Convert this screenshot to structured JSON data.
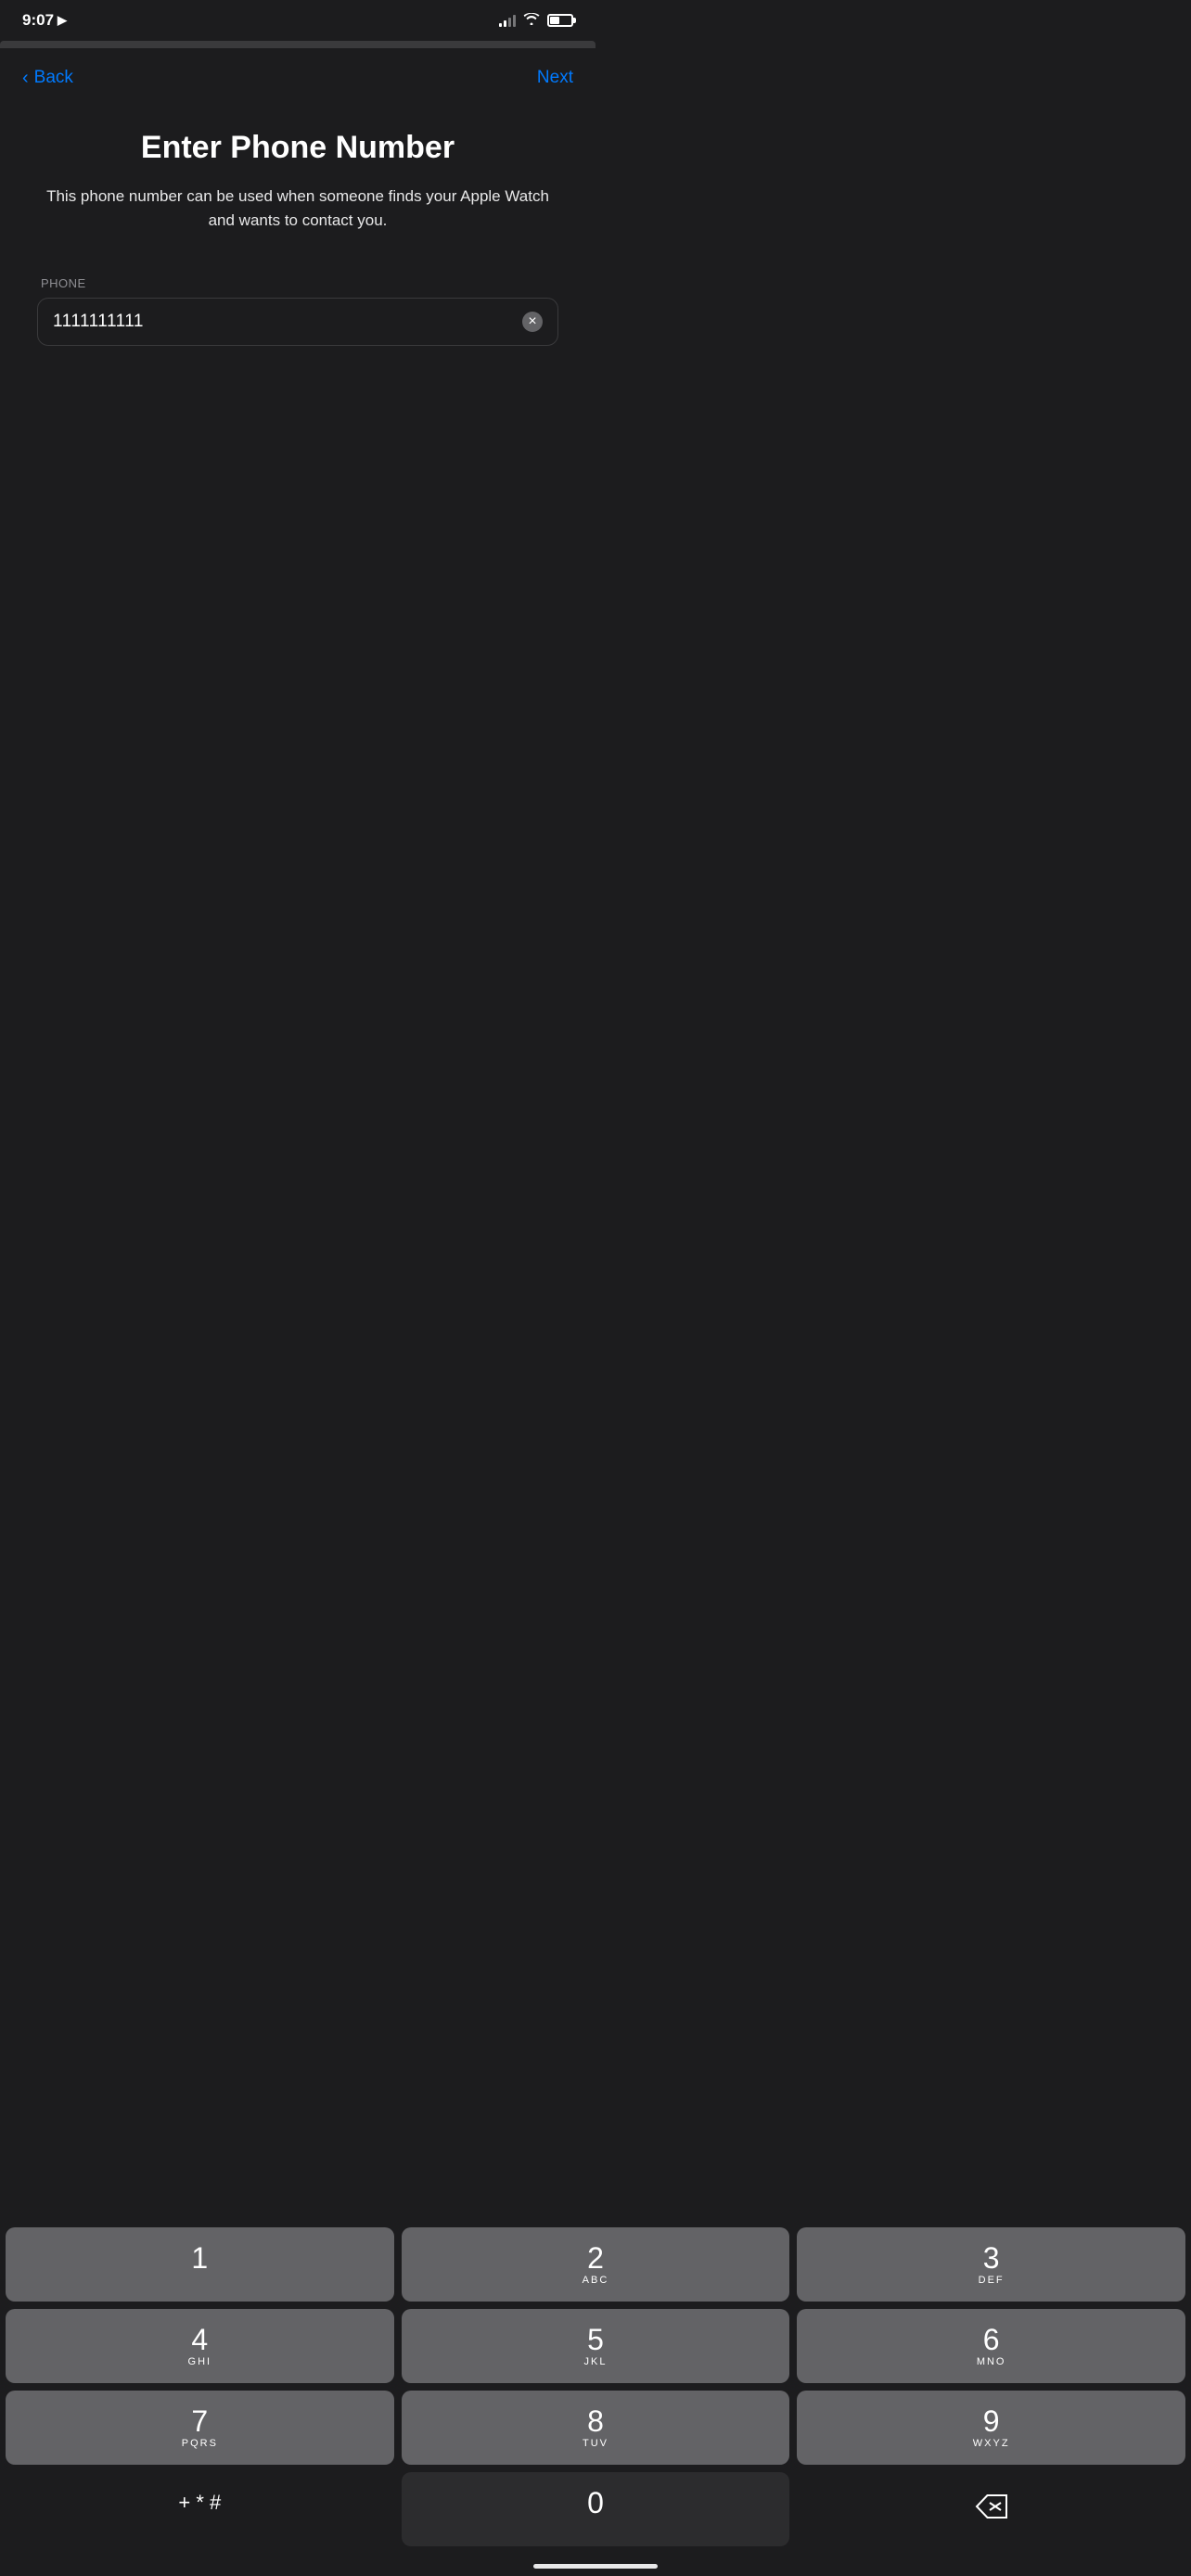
{
  "statusBar": {
    "time": "9:07",
    "locationIcon": "▶"
  },
  "nav": {
    "backLabel": "Back",
    "nextLabel": "Next"
  },
  "page": {
    "title": "Enter Phone Number",
    "subtitle": "This phone number can be used when someone finds your Apple Watch and wants to contact you."
  },
  "phoneField": {
    "label": "PHONE",
    "value": "1111111111",
    "clearLabel": "clear"
  },
  "keypad": {
    "rows": [
      [
        {
          "main": "1",
          "sub": ""
        },
        {
          "main": "2",
          "sub": "ABC"
        },
        {
          "main": "3",
          "sub": "DEF"
        }
      ],
      [
        {
          "main": "4",
          "sub": "GHI"
        },
        {
          "main": "5",
          "sub": "JKL"
        },
        {
          "main": "6",
          "sub": "MNO"
        }
      ],
      [
        {
          "main": "7",
          "sub": "PQRS"
        },
        {
          "main": "8",
          "sub": "TUV"
        },
        {
          "main": "9",
          "sub": "WXYZ"
        }
      ],
      [
        {
          "main": "+ * #",
          "sub": "",
          "type": "symbols"
        },
        {
          "main": "0",
          "sub": "",
          "type": "dark"
        },
        {
          "main": "⌫",
          "sub": "",
          "type": "backspace"
        }
      ]
    ]
  }
}
